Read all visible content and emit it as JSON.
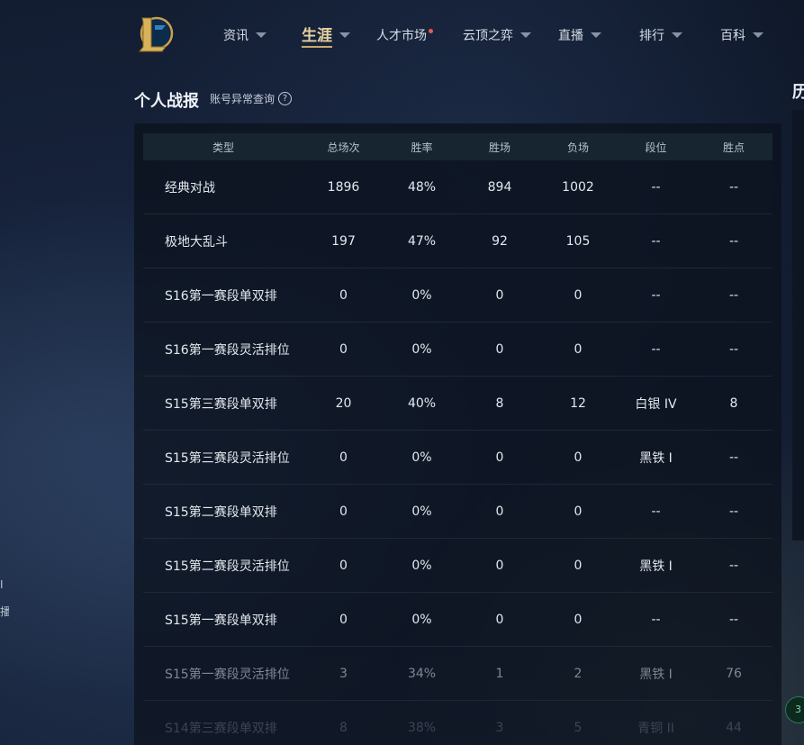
{
  "nav": {
    "items": [
      {
        "label": "资讯",
        "caret": true,
        "active": false,
        "dot": false
      },
      {
        "label": "生涯",
        "caret": true,
        "active": true,
        "dot": false
      },
      {
        "label": "人才市场",
        "caret": false,
        "active": false,
        "dot": true
      },
      {
        "label": "云顶之弈",
        "caret": true,
        "active": false,
        "dot": false
      },
      {
        "label": "直播",
        "caret": true,
        "active": false,
        "dot": false
      },
      {
        "label": "排行",
        "caret": true,
        "active": false,
        "dot": false
      },
      {
        "label": "百科",
        "caret": true,
        "active": false,
        "dot": false
      }
    ]
  },
  "page": {
    "title": "个人战报",
    "account_query": "账号异常查询",
    "help_glyph": "?",
    "side_title": "历",
    "side_badge": "3",
    "left_fragments": [
      "I",
      "播"
    ]
  },
  "table": {
    "headers": {
      "type": "类型",
      "total": "总场次",
      "rate": "胜率",
      "win": "胜场",
      "loss": "负场",
      "rank": "段位",
      "lp": "胜点"
    },
    "rows": [
      {
        "type": "经典对战",
        "total": "1896",
        "rate": "48%",
        "win": "894",
        "loss": "1002",
        "rank": "--",
        "lp": "--"
      },
      {
        "type": "极地大乱斗",
        "total": "197",
        "rate": "47%",
        "win": "92",
        "loss": "105",
        "rank": "--",
        "lp": "--"
      },
      {
        "type": "S16第一赛段单双排",
        "total": "0",
        "rate": "0%",
        "win": "0",
        "loss": "0",
        "rank": "--",
        "lp": "--"
      },
      {
        "type": "S16第一赛段灵活排位",
        "total": "0",
        "rate": "0%",
        "win": "0",
        "loss": "0",
        "rank": "--",
        "lp": "--"
      },
      {
        "type": "S15第三赛段单双排",
        "total": "20",
        "rate": "40%",
        "win": "8",
        "loss": "12",
        "rank": "白银 IV",
        "lp": "8"
      },
      {
        "type": "S15第三赛段灵活排位",
        "total": "0",
        "rate": "0%",
        "win": "0",
        "loss": "0",
        "rank": "黑铁 I",
        "lp": "--"
      },
      {
        "type": "S15第二赛段单双排",
        "total": "0",
        "rate": "0%",
        "win": "0",
        "loss": "0",
        "rank": "--",
        "lp": "--"
      },
      {
        "type": "S15第二赛段灵活排位",
        "total": "0",
        "rate": "0%",
        "win": "0",
        "loss": "0",
        "rank": "黑铁 I",
        "lp": "--"
      },
      {
        "type": "S15第一赛段单双排",
        "total": "0",
        "rate": "0%",
        "win": "0",
        "loss": "0",
        "rank": "--",
        "lp": "--"
      },
      {
        "type": "S15第一赛段灵活排位",
        "total": "3",
        "rate": "34%",
        "win": "1",
        "loss": "2",
        "rank": "黑铁 I",
        "lp": "76"
      },
      {
        "type": "S14第三赛段单双排",
        "total": "8",
        "rate": "38%",
        "win": "3",
        "loss": "5",
        "rank": "青铜 II",
        "lp": "44"
      }
    ]
  },
  "colors": {
    "accent_gold": "#c9aa6c",
    "nav_dot": "#e35d52"
  }
}
